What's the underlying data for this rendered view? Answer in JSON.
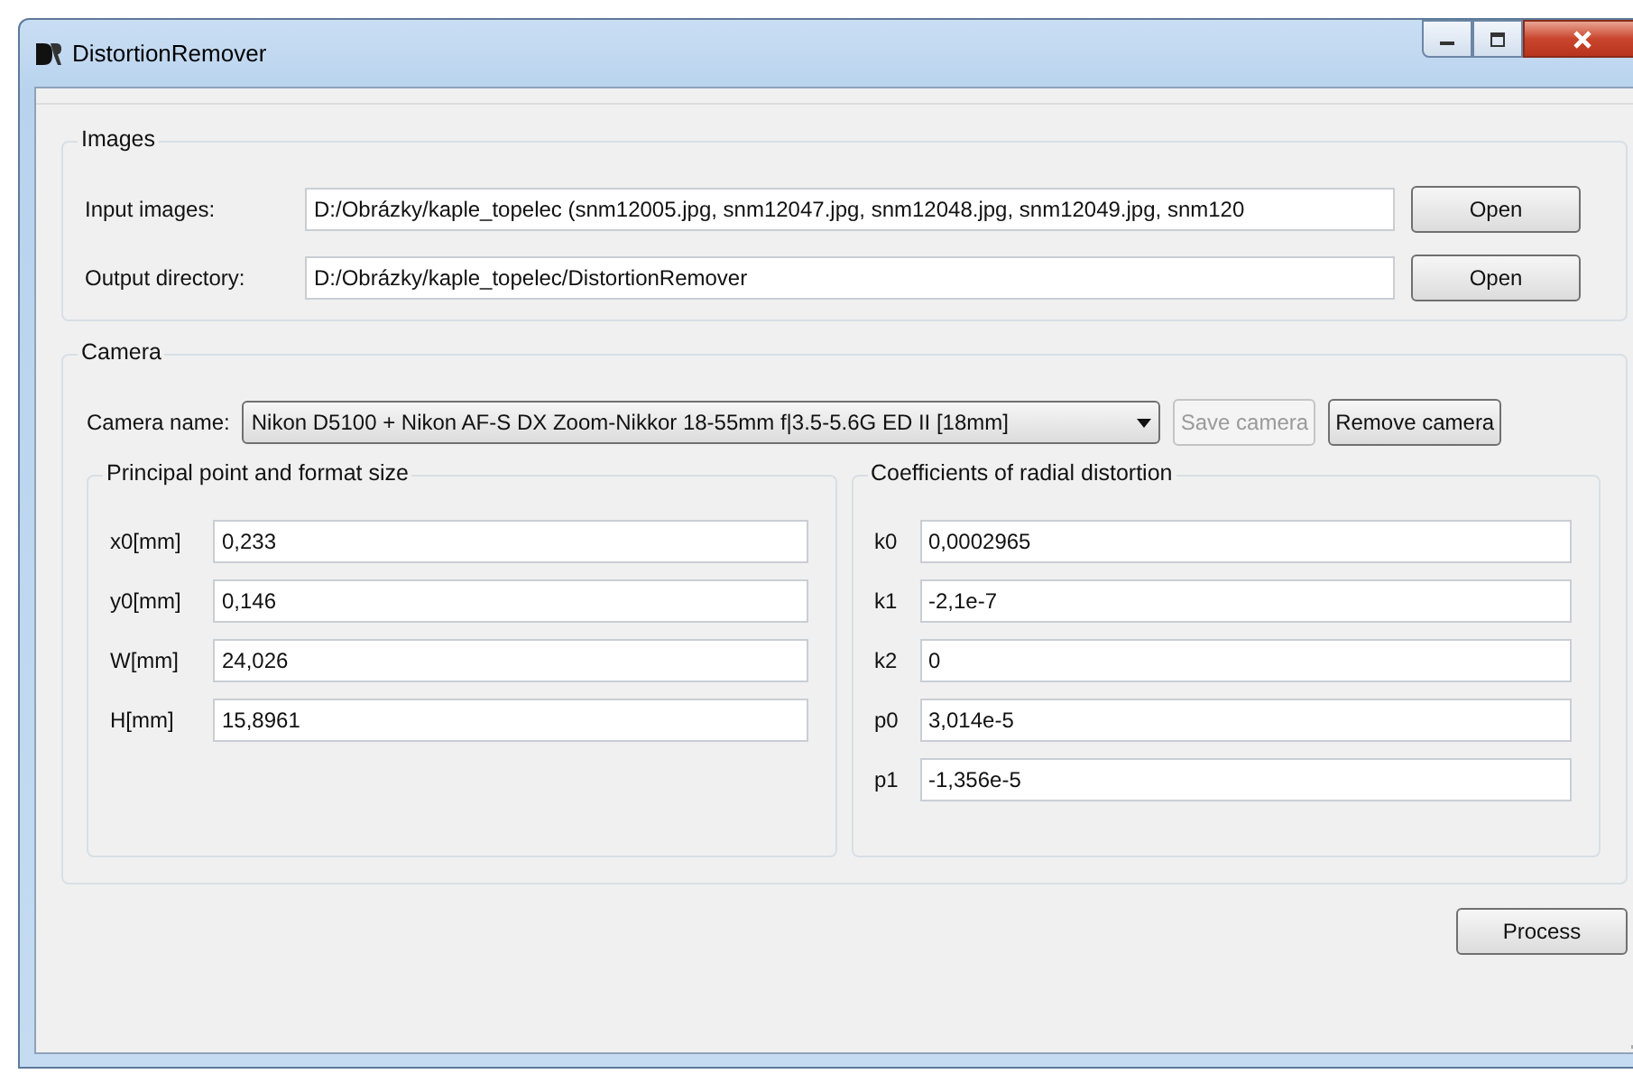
{
  "window": {
    "title": "DistortionRemover"
  },
  "images": {
    "title": "Images",
    "rows": [
      {
        "label": "Input images:",
        "value": "D:/Obrázky/kaple_topelec (snm12005.jpg, snm12047.jpg, snm12048.jpg, snm12049.jpg, snm120",
        "button": "Open"
      },
      {
        "label": "Output directory:",
        "value": "D:/Obrázky/kaple_topelec/DistortionRemover",
        "button": "Open"
      }
    ]
  },
  "camera": {
    "title": "Camera",
    "name_label": "Camera name:",
    "selected_camera": "Nikon D5100 + Nikon AF-S DX Zoom-Nikkor 18-55mm f|3.5-5.6G ED II [18mm]",
    "buttons": [
      {
        "label": "Save camera",
        "disabled": true
      },
      {
        "label": "Remove camera",
        "disabled": false
      }
    ],
    "groups": [
      {
        "title": "Principal point and format size",
        "fields": [
          {
            "label": "x0[mm]",
            "value": "0,233"
          },
          {
            "label": "y0[mm]",
            "value": "0,146"
          },
          {
            "label": "W[mm]",
            "value": "24,026"
          },
          {
            "label": "H[mm]",
            "value": "15,8961"
          }
        ]
      },
      {
        "title": "Coefficients of radial distortion",
        "fields": [
          {
            "label": "k0",
            "value": "0,0002965"
          },
          {
            "label": "k1",
            "value": "-2,1e-7"
          },
          {
            "label": "k2",
            "value": "0"
          },
          {
            "label": "p0",
            "value": "3,014e-5"
          },
          {
            "label": "p1",
            "value": "-1,356e-5"
          }
        ]
      }
    ]
  },
  "process_button": "Process"
}
